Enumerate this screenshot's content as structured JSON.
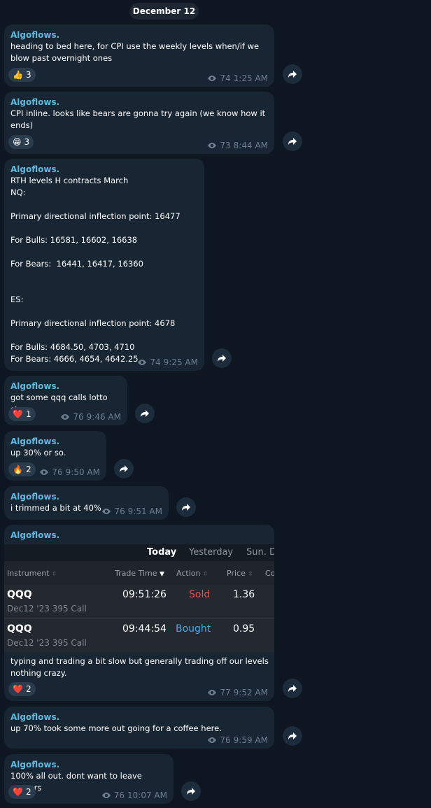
{
  "date_label": "December 12",
  "author": "Algoflows.",
  "colors": {
    "background": "#0e1621",
    "bubble": "#182533",
    "author": "#5fb9e0",
    "sold": "#e0514f",
    "bought": "#4ea9e0"
  },
  "messages": [
    {
      "text": "heading to bed here, for CPI use the weekly levels when/if we blow past overnight ones",
      "reaction": {
        "emoji": "👍",
        "count": "3"
      },
      "views": "74",
      "time": "1:25 AM"
    },
    {
      "text": "CPI inline. looks like bears are gonna try again (we know how it ends)",
      "reaction": {
        "emoji": "😁",
        "count": "3"
      },
      "views": "73",
      "time": "8:44 AM"
    },
    {
      "text": "RTH levels H contracts March\nNQ:\n\nPrimary directional inflection point: 16477\n\nFor Bulls: 16581, 16602, 16638\n\nFor Bears:  16441, 16417, 16360\n\n\nES:\n\nPrimary directional inflection point: 4678\n\nFor Bulls: 4684.50, 4703, 4710\nFor Bears: 4666, 4654, 4642.25",
      "views": "74",
      "time": "9:25 AM"
    },
    {
      "text": "got some qqq calls lotto size",
      "reaction": {
        "emoji": "❤️",
        "count": "1"
      },
      "views": "76",
      "time": "9:46 AM"
    },
    {
      "text": "up 30% or so.",
      "reaction": {
        "emoji": "🔥",
        "count": "2"
      },
      "views": "76",
      "time": "9:50 AM"
    },
    {
      "text": "i trimmed a bit at 40%",
      "views": "76",
      "time": "9:51 AM"
    },
    {
      "trade_screenshot": {
        "tabs": [
          "Today",
          "Yesterday",
          "Sun. D"
        ],
        "columns": [
          "Instrument",
          "Trade Time",
          "Action",
          "Price",
          "Co"
        ],
        "rows": [
          {
            "symbol": "QQQ",
            "contract": "Dec12 '23 395 Call",
            "time": "09:51:26",
            "action": "Sold",
            "price": "1.36"
          },
          {
            "symbol": "QQQ",
            "contract": "Dec12 '23 395 Call",
            "time": "09:44:54",
            "action": "Bought",
            "price": "0.95"
          }
        ]
      },
      "text": "typing and trading a bit slow but generally trading off our levels nothing crazy.",
      "reaction": {
        "emoji": "❤️",
        "count": "2"
      },
      "views": "77",
      "time": "9:52 AM"
    },
    {
      "text": "up 70% took some more out going for a coffee here.",
      "views": "76",
      "time": "9:59 AM"
    },
    {
      "text": "100% all out. dont want to leave runners",
      "reaction": {
        "emoji": "❤️",
        "count": "2"
      },
      "views": "76",
      "time": "10:07 AM"
    }
  ]
}
